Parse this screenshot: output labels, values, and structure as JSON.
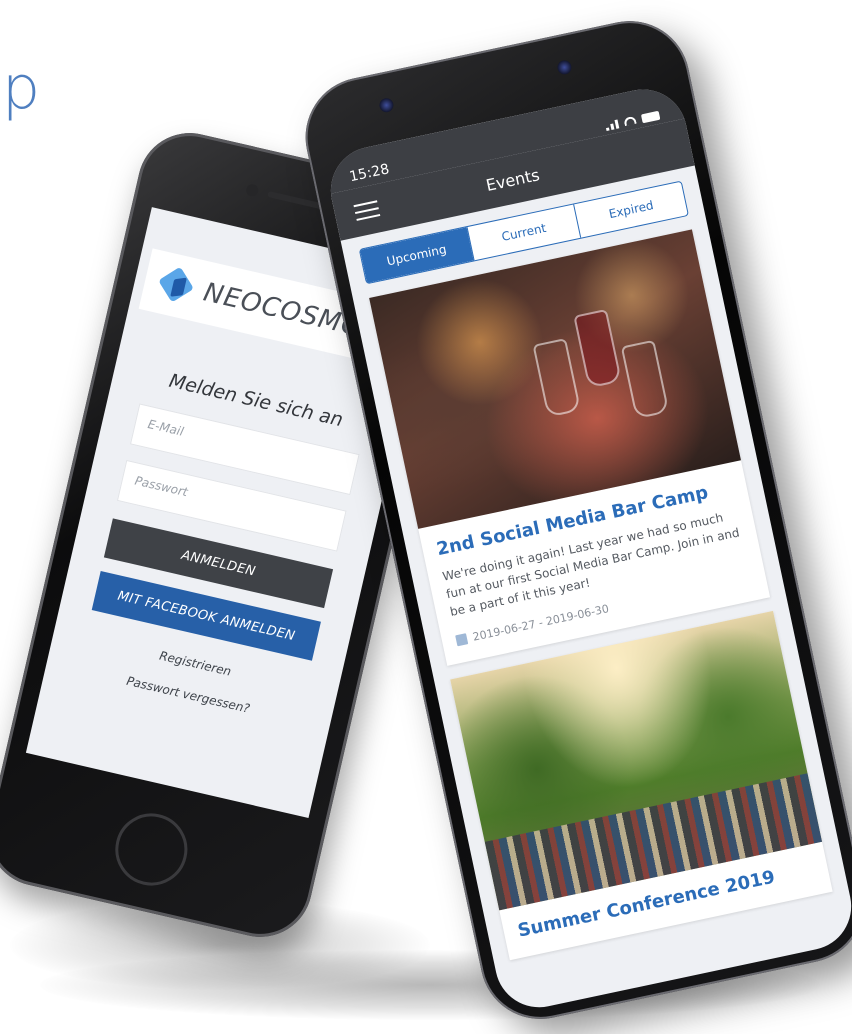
{
  "headline": {
    "fragment": "p"
  },
  "login": {
    "brand": "NEOCOSMO",
    "title": "Melden Sie sich an",
    "email_placeholder": "E-Mail",
    "password_placeholder": "Passwort",
    "login_button": "ANMELDEN",
    "facebook_button": "MIT FACEBOOK ANMELDEN",
    "register_link": "Registrieren",
    "forgot_link": "Passwort vergessen?"
  },
  "events": {
    "status_time": "15:28",
    "nav_title": "Events",
    "tabs": [
      {
        "label": "Upcoming",
        "active": true
      },
      {
        "label": "Current",
        "active": false
      },
      {
        "label": "Expired",
        "active": false
      }
    ],
    "cards": [
      {
        "title": "2nd Social Media Bar Camp",
        "description": "We're doing it again! Last year we had so much fun at our first Social Media Bar Camp. Join in and be a part of it this year!",
        "date": "2019-06-27 - 2019-06-30"
      },
      {
        "title": "Summer Conference 2019"
      }
    ]
  },
  "colors": {
    "accent": "#2b6cb8",
    "facebook": "#2760a8",
    "dark_bar": "#3d3f44"
  }
}
